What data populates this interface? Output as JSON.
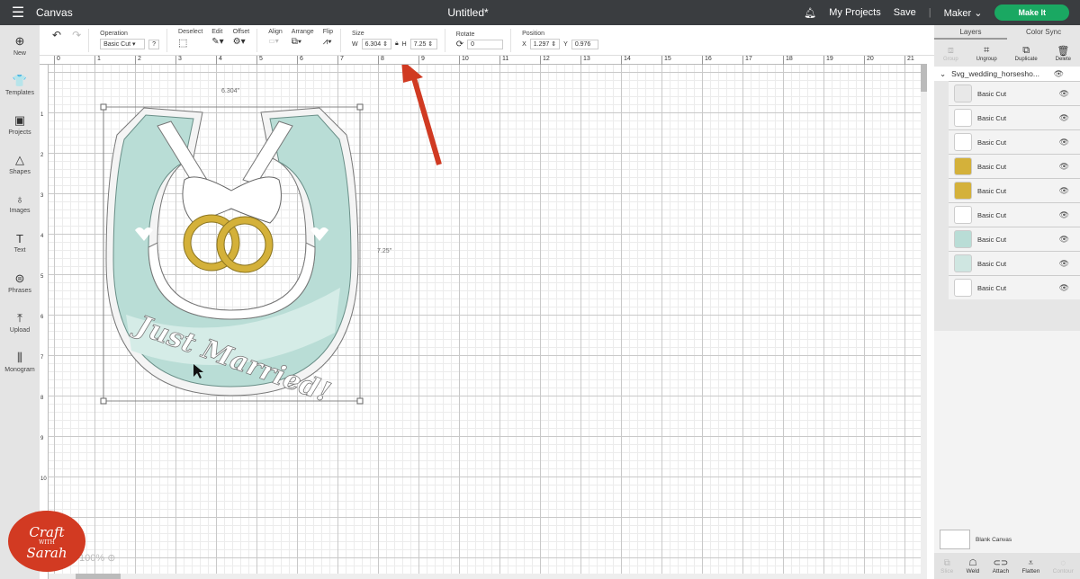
{
  "topbar": {
    "app": "Canvas",
    "title": "Untitled*",
    "my_projects": "My Projects",
    "save": "Save",
    "machine": "Maker",
    "make_it": "Make It"
  },
  "toolbar": {
    "operation_label": "Operation",
    "operation_value": "Basic Cut",
    "help": "?",
    "deselect": "Deselect",
    "edit": "Edit",
    "offset": "Offset",
    "align": "Align",
    "arrange": "Arrange",
    "flip": "Flip",
    "size_label": "Size",
    "w_label": "W",
    "w": "6.304",
    "h_label": "H",
    "h": "7.25",
    "rotate_label": "Rotate",
    "rotate": "0",
    "position_label": "Position",
    "x_label": "X",
    "x": "1.297",
    "y_label": "Y",
    "y": "0.976"
  },
  "sidebar": {
    "items": [
      {
        "label": "New",
        "icon": "plus-circle-icon",
        "g": "⊕"
      },
      {
        "label": "Templates",
        "icon": "shirt-icon",
        "g": "👕"
      },
      {
        "label": "Projects",
        "icon": "projects-icon",
        "g": "▣"
      },
      {
        "label": "Shapes",
        "icon": "shapes-icon",
        "g": "△"
      },
      {
        "label": "Images",
        "icon": "bulb-icon",
        "g": "♁"
      },
      {
        "label": "Text",
        "icon": "text-icon",
        "g": "T"
      },
      {
        "label": "Phrases",
        "icon": "speech-icon",
        "g": "⊜"
      },
      {
        "label": "Upload",
        "icon": "upload-icon",
        "g": "⤒"
      },
      {
        "label": "Monogram",
        "icon": "monogram-icon",
        "g": "⫼"
      }
    ]
  },
  "ruler": {
    "h": [
      "0",
      "1",
      "2",
      "3",
      "4",
      "5",
      "6",
      "7",
      "8",
      "9",
      "10",
      "11",
      "12",
      "13",
      "14",
      "15",
      "16",
      "17",
      "18",
      "19",
      "20",
      "21"
    ],
    "v": [
      "1",
      "2",
      "3",
      "4",
      "5",
      "6",
      "7",
      "8",
      "9",
      "10",
      "11"
    ]
  },
  "canvas": {
    "width_label": "6.304\"",
    "height_label": "7.25\"",
    "zoom": "100%",
    "text": "Just Married!"
  },
  "panel": {
    "tabs": [
      "Layers",
      "Color Sync"
    ],
    "tools": [
      "Group",
      "Ungroup",
      "Duplicate",
      "Delete"
    ],
    "group_name": "Svg_wedding_horsesho...",
    "layers": [
      {
        "name": "Basic Cut",
        "color": "#e8e8e8"
      },
      {
        "name": "Basic Cut",
        "color": "#ffffff"
      },
      {
        "name": "Basic Cut",
        "color": "#ffffff"
      },
      {
        "name": "Basic Cut",
        "color": "#d4b13a"
      },
      {
        "name": "Basic Cut",
        "color": "#d4b13a"
      },
      {
        "name": "Basic Cut",
        "color": "#ffffff"
      },
      {
        "name": "Basic Cut",
        "color": "#b9ddd6"
      },
      {
        "name": "Basic Cut",
        "color": "#cfe6e1"
      },
      {
        "name": "Basic Cut",
        "color": "#ffffff"
      }
    ],
    "blank_canvas": "Blank Canvas",
    "bottom": [
      "Slice",
      "Weld",
      "Attach",
      "Flatten",
      "Contour"
    ]
  },
  "logo": {
    "line1": "Craft",
    "line2": "WITH",
    "line3": "Sarah"
  },
  "colors": {
    "accent": "#1aa862",
    "mint": "#b9ddd6",
    "gold": "#d4b13a",
    "arrow": "#d03a22"
  }
}
